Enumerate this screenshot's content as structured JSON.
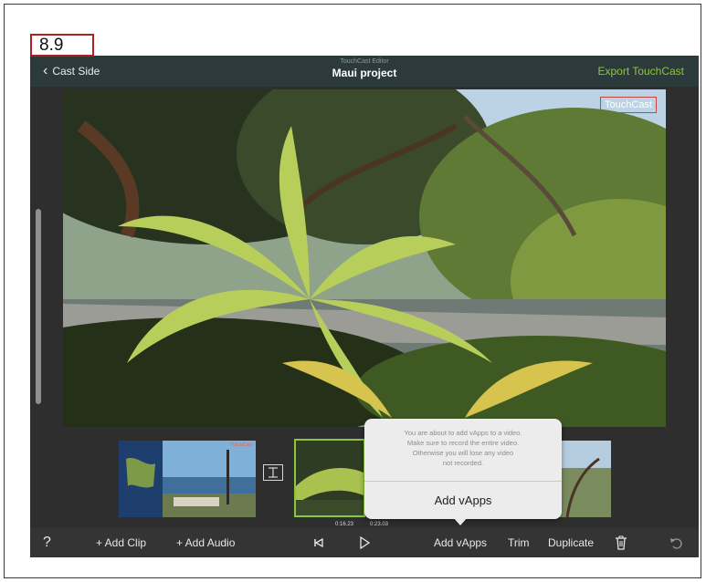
{
  "figure_label": "8.9",
  "navbar": {
    "back_label": "Cast Side",
    "subtitle": "TouchCast Editor",
    "title": "Maui project",
    "export_label": "Export TouchCast",
    "accent": "#8bc63f"
  },
  "video": {
    "watermark": "TouchCast"
  },
  "timeline": {
    "playhead_time": "0:16.23",
    "end_time": "0:23.03",
    "first_clip_badge": "TouchCast"
  },
  "popover": {
    "message_lines": [
      "You are about to add vApps to a video.",
      "Make sure to record the entire video.",
      "Otherwise you will lose any video",
      "not recorded."
    ],
    "button_label": "Add vApps"
  },
  "toolbar": {
    "help_label": "?",
    "add_clip_label": "+ Add Clip",
    "add_audio_label": "+ Add Audio",
    "rewind_icon": "skip-to-start-icon",
    "play_icon": "play-icon",
    "add_vapps_label": "Add vApps",
    "trim_label": "Trim",
    "duplicate_label": "Duplicate",
    "delete_icon": "trash-icon",
    "undo_icon": "undo-icon"
  }
}
